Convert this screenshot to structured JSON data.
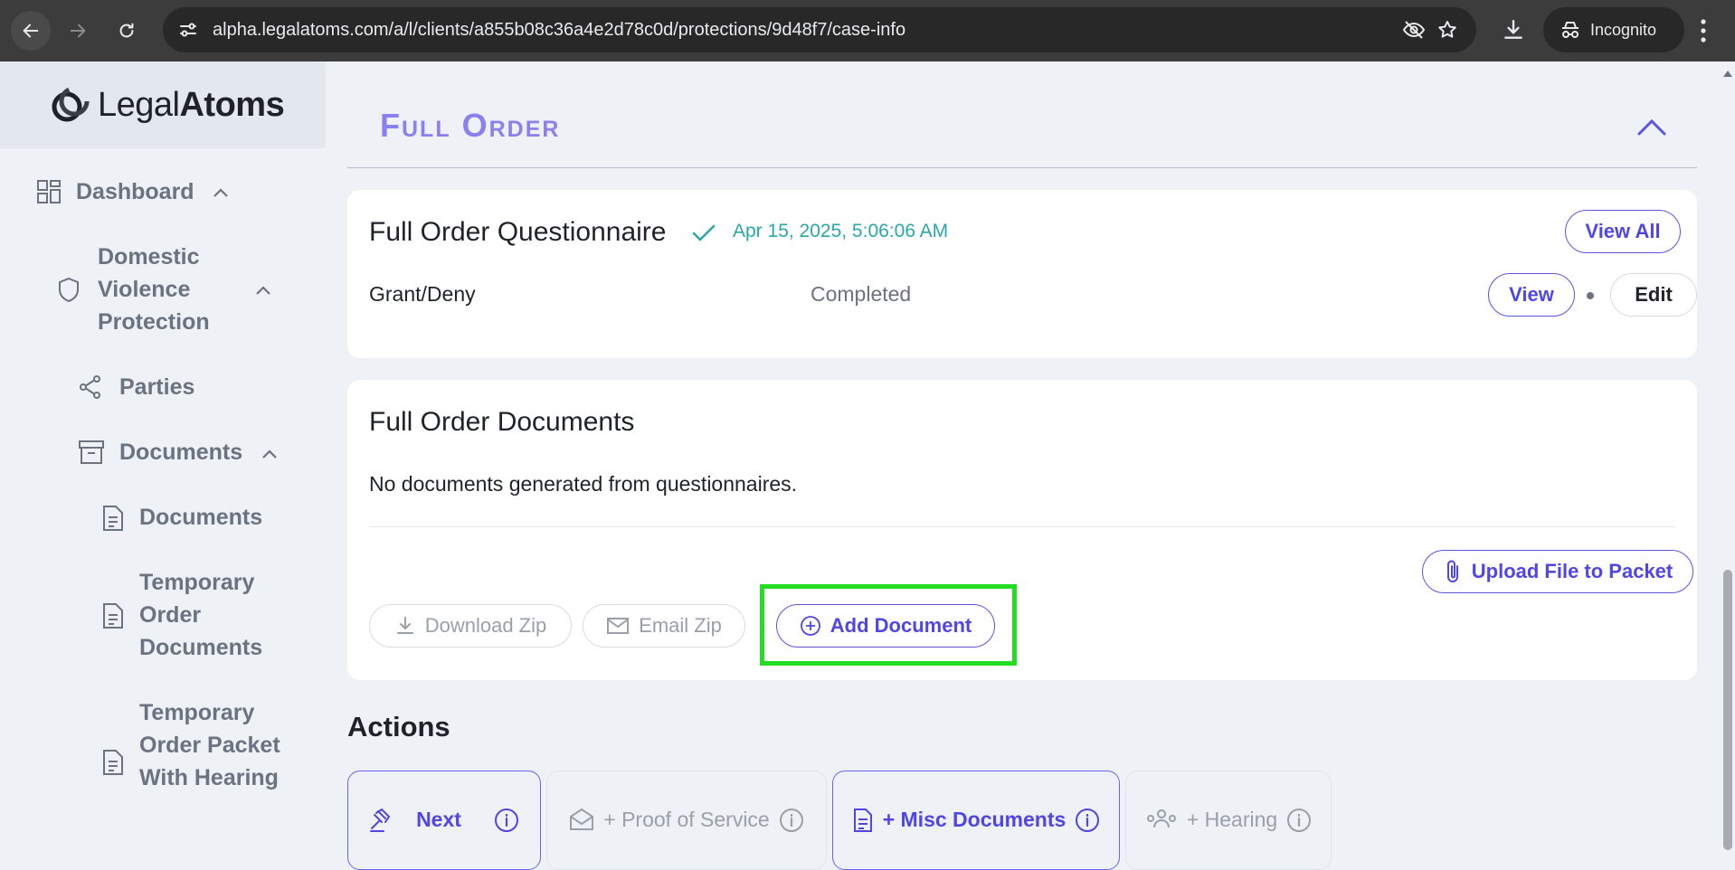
{
  "browser": {
    "url": "alpha.legalatoms.com/a/l/clients/a855b08c36a4e2d78c0d/protections/9d48f7/case-info",
    "incognito_label": "Incognito"
  },
  "sidebar": {
    "logo": {
      "regular": "Legal",
      "bold": "Atoms"
    },
    "items": [
      {
        "label": "Dashboard"
      },
      {
        "label": "Domestic Violence Protection"
      },
      {
        "label": "Parties"
      },
      {
        "label": "Documents"
      },
      {
        "label": "Documents"
      },
      {
        "label": "Temporary Order Documents"
      },
      {
        "label": "Temporary Order Packet With Hearing"
      }
    ]
  },
  "main": {
    "section_title": "Full Order",
    "questionnaire": {
      "title": "Full Order Questionnaire",
      "timestamp": "Apr 15, 2025, 5:06:06 AM",
      "view_all_label": "View All",
      "row_name": "Grant/Deny",
      "row_status": "Completed",
      "view_label": "View",
      "edit_label": "Edit"
    },
    "documents": {
      "title": "Full Order Documents",
      "empty_text": "No documents generated from questionnaires.",
      "upload_label": "Upload File to Packet",
      "download_zip_label": "Download Zip",
      "email_zip_label": "Email Zip",
      "add_document_label": "Add Document"
    },
    "actions": {
      "title": "Actions",
      "items": [
        {
          "label": "Next"
        },
        {
          "label": "+ Proof of Service"
        },
        {
          "label": "+ Misc Documents"
        },
        {
          "label": "+ Hearing"
        }
      ]
    }
  },
  "colors": {
    "accent": "#4f46e5",
    "section_title": "#8b80ef",
    "timestamp": "#2aa7a8",
    "highlight": "#22dd22"
  }
}
